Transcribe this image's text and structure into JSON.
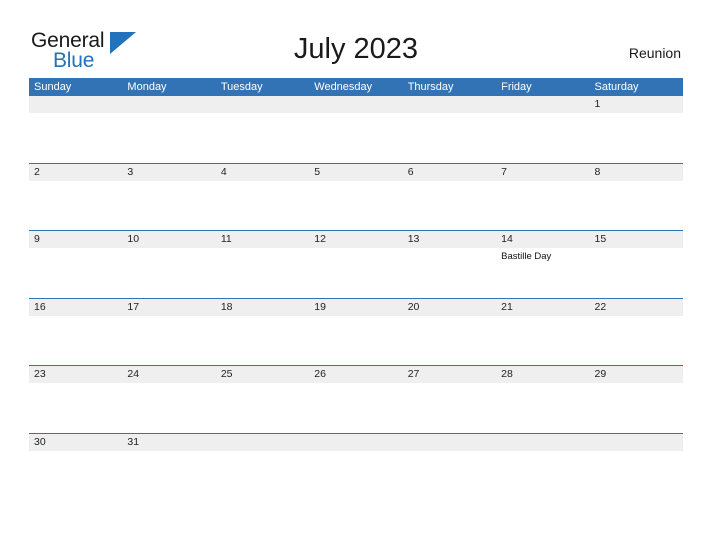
{
  "brand": {
    "word_one": "General",
    "word_two": "Blue",
    "accent_color": "#2273bb"
  },
  "header": {
    "title": "July 2023",
    "region": "Reunion"
  },
  "theme": {
    "header_blue": "#3273b5",
    "band_gray": "#efefef",
    "text_dark": "#222222"
  },
  "calendar": {
    "weekday_headers": [
      "Sunday",
      "Monday",
      "Tuesday",
      "Wednesday",
      "Thursday",
      "Friday",
      "Saturday"
    ],
    "weeks": [
      [
        {
          "day": "",
          "events": []
        },
        {
          "day": "",
          "events": []
        },
        {
          "day": "",
          "events": []
        },
        {
          "day": "",
          "events": []
        },
        {
          "day": "",
          "events": []
        },
        {
          "day": "",
          "events": []
        },
        {
          "day": "1",
          "events": []
        }
      ],
      [
        {
          "day": "2",
          "events": []
        },
        {
          "day": "3",
          "events": []
        },
        {
          "day": "4",
          "events": []
        },
        {
          "day": "5",
          "events": []
        },
        {
          "day": "6",
          "events": []
        },
        {
          "day": "7",
          "events": []
        },
        {
          "day": "8",
          "events": []
        }
      ],
      [
        {
          "day": "9",
          "events": []
        },
        {
          "day": "10",
          "events": []
        },
        {
          "day": "11",
          "events": []
        },
        {
          "day": "12",
          "events": []
        },
        {
          "day": "13",
          "events": []
        },
        {
          "day": "14",
          "events": [
            "Bastille Day"
          ]
        },
        {
          "day": "15",
          "events": []
        }
      ],
      [
        {
          "day": "16",
          "events": []
        },
        {
          "day": "17",
          "events": []
        },
        {
          "day": "18",
          "events": []
        },
        {
          "day": "19",
          "events": []
        },
        {
          "day": "20",
          "events": []
        },
        {
          "day": "21",
          "events": []
        },
        {
          "day": "22",
          "events": []
        }
      ],
      [
        {
          "day": "23",
          "events": []
        },
        {
          "day": "24",
          "events": []
        },
        {
          "day": "25",
          "events": []
        },
        {
          "day": "26",
          "events": []
        },
        {
          "day": "27",
          "events": []
        },
        {
          "day": "28",
          "events": []
        },
        {
          "day": "29",
          "events": []
        }
      ],
      [
        {
          "day": "30",
          "events": []
        },
        {
          "day": "31",
          "events": []
        },
        {
          "day": "",
          "events": []
        },
        {
          "day": "",
          "events": []
        },
        {
          "day": "",
          "events": []
        },
        {
          "day": "",
          "events": []
        },
        {
          "day": "",
          "events": []
        }
      ]
    ]
  }
}
